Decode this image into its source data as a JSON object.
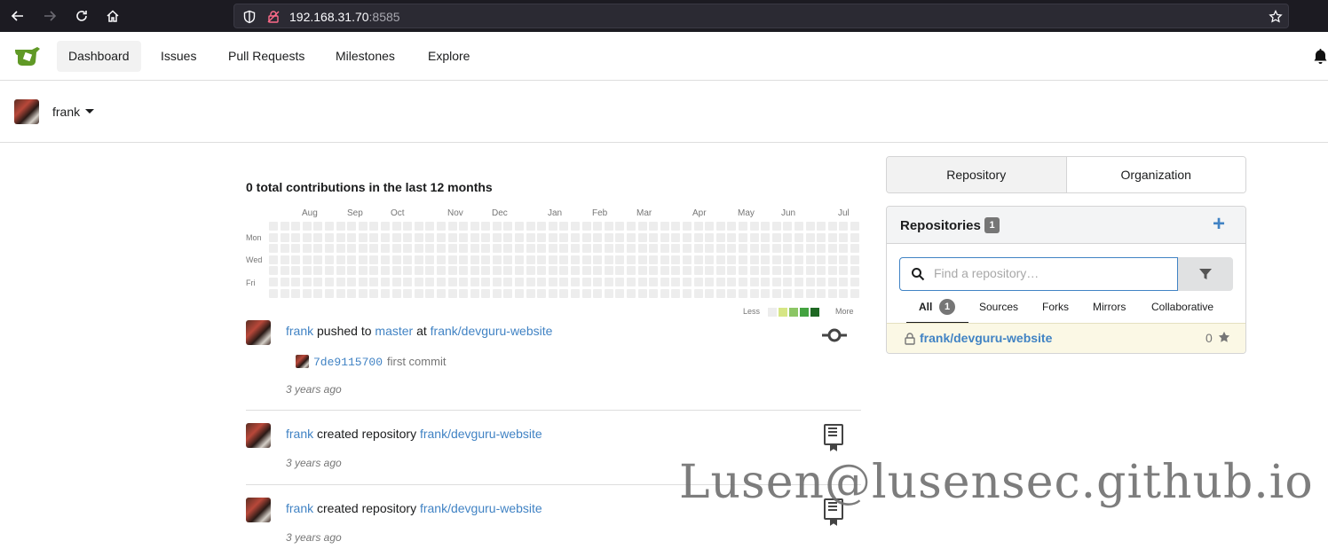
{
  "browser": {
    "url_host": "192.168.31.70",
    "url_port": ":8585"
  },
  "header": {
    "menu": [
      {
        "label": "Dashboard"
      },
      {
        "label": "Issues"
      },
      {
        "label": "Pull Requests"
      },
      {
        "label": "Milestones"
      },
      {
        "label": "Explore"
      }
    ]
  },
  "user": {
    "name": "frank"
  },
  "heatmap": {
    "title": "0 total contributions in the last 12 months",
    "months": [
      "Aug",
      "Sep",
      "Oct",
      "Nov",
      "Dec",
      "Jan",
      "Feb",
      "Mar",
      "Apr",
      "May",
      "Jun",
      "Jul"
    ],
    "days": [
      "Mon",
      "Wed",
      "Fri"
    ],
    "legend_less": "Less",
    "legend_more": "More",
    "legend_colors": [
      "#ededed",
      "#d6e685",
      "#8cc665",
      "#44a340",
      "#1e6823"
    ]
  },
  "feed": [
    {
      "user": "frank",
      "action": " pushed to ",
      "branch": "master",
      "at": " at ",
      "repo": "frank/devguru-website",
      "commit_sha": "7de9115700",
      "commit_msg": "first commit",
      "time": "3 years ago",
      "icon": "git-commit-icon"
    },
    {
      "user": "frank",
      "action": " created repository ",
      "repo": "frank/devguru-website",
      "time": "3 years ago",
      "icon": "book-icon"
    },
    {
      "user": "frank",
      "action": " created repository ",
      "repo": "frank/devguru-website",
      "time": "3 years ago",
      "icon": "book-icon"
    }
  ],
  "panel": {
    "switch": {
      "repository": "Repository",
      "organization": "Organization"
    },
    "title": "Repositories",
    "count": "1",
    "search_placeholder": "Find a repository…",
    "tabs": [
      {
        "label": "All",
        "count": "1"
      },
      {
        "label": "Sources"
      },
      {
        "label": "Forks"
      },
      {
        "label": "Mirrors"
      },
      {
        "label": "Collaborative"
      }
    ],
    "repo": {
      "name": "frank/devguru-website",
      "stars": "0"
    }
  },
  "watermark": "Lusen@lusensec.github.io",
  "colors": {
    "link": "#4183c4",
    "browser_bg": "#1c1b22"
  }
}
